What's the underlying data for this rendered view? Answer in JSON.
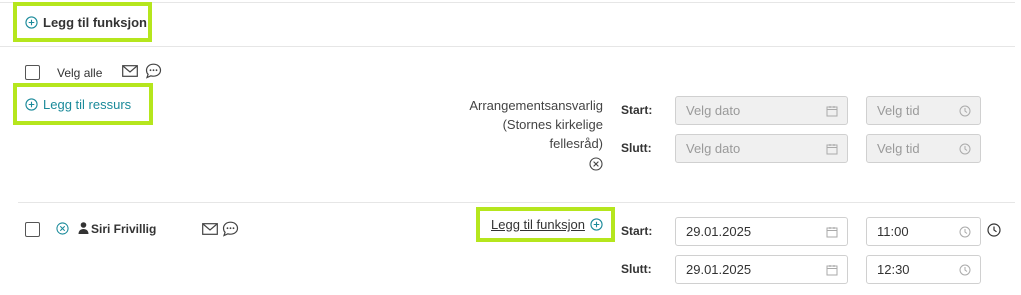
{
  "top": {
    "add_function_label": "Legg til funksjon"
  },
  "resources": {
    "select_all_label": "Velg alle",
    "add_resource_label": "Legg til ressurs"
  },
  "responsible": {
    "owner_lines": [
      "Arrangementsansvarlig",
      "(Stornes kirkelige",
      "fellesråd)"
    ],
    "start_label": "Start:",
    "end_label": "Slutt:",
    "date_placeholder": "Velg dato",
    "time_placeholder": "Velg tid"
  },
  "person": {
    "name": "Siri Frivillig",
    "add_function_label": "Legg til funksjon",
    "start_label": "Start:",
    "end_label": "Slutt:",
    "start_date": "29.01.2025",
    "start_time": "11:00",
    "end_date": "29.01.2025",
    "end_time": "12:30"
  },
  "colors": {
    "accent": "#1a8a9a",
    "highlight": "#b5e61d",
    "border": "#d0d0d0"
  }
}
